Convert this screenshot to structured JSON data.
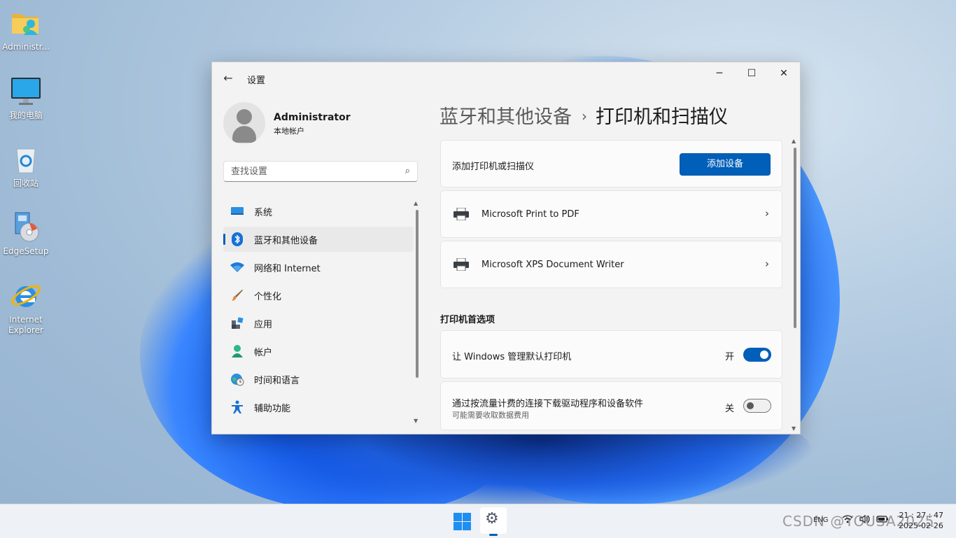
{
  "desktop": {
    "icons": [
      {
        "label": "Administr...",
        "icon": "user-folder-icon"
      },
      {
        "label": "我的电脑",
        "icon": "monitor-icon"
      },
      {
        "label": "回收站",
        "icon": "recycle-bin-icon"
      },
      {
        "label": "EdgeSetup",
        "icon": "installer-disc-icon"
      },
      {
        "label": "Internet\nExplorer",
        "icon": "internet-explorer-icon"
      }
    ]
  },
  "window": {
    "app_title": "设置",
    "back_icon": "back-arrow-icon",
    "controls": {
      "minimize": "─",
      "maximize": "☐",
      "close": "✕"
    }
  },
  "profile": {
    "name": "Administrator",
    "account_type": "本地帐户"
  },
  "search": {
    "placeholder": "查找设置",
    "icon": "search-icon"
  },
  "nav": {
    "items": [
      {
        "label": "系统",
        "icon": "system-icon",
        "active": false
      },
      {
        "label": "蓝牙和其他设备",
        "icon": "bluetooth-icon",
        "active": true
      },
      {
        "label": "网络和 Internet",
        "icon": "wifi-icon",
        "active": false
      },
      {
        "label": "个性化",
        "icon": "brush-icon",
        "active": false
      },
      {
        "label": "应用",
        "icon": "apps-icon",
        "active": false
      },
      {
        "label": "帐户",
        "icon": "account-icon",
        "active": false
      },
      {
        "label": "时间和语言",
        "icon": "globe-clock-icon",
        "active": false
      },
      {
        "label": "辅助功能",
        "icon": "accessibility-icon",
        "active": false
      }
    ]
  },
  "breadcrumb": {
    "parent": "蓝牙和其他设备",
    "separator": "›",
    "current": "打印机和扫描仪"
  },
  "add_device": {
    "label": "添加打印机或扫描仪",
    "button": "添加设备"
  },
  "printers": [
    {
      "name": "Microsoft Print to PDF"
    },
    {
      "name": "Microsoft XPS Document Writer"
    }
  ],
  "preferences": {
    "title": "打印机首选项",
    "settings": [
      {
        "label": "让 Windows 管理默认打印机",
        "state_text": "开",
        "on": true
      },
      {
        "label": "通过按流量计费的连接下载驱动程序和设备软件",
        "description": "可能需要收取数据费用",
        "state_text": "关",
        "on": false
      }
    ]
  },
  "taskbar": {
    "tray": {
      "lang": "ENG",
      "wifi": "wifi-icon",
      "sound": "speaker-icon",
      "battery": "battery-icon"
    },
    "time": "21 : 27 : 47",
    "date": "2025-02-26"
  },
  "watermark": "CSDN @YOUSA2025",
  "colors": {
    "accent": "#005fb8",
    "window_bg": "#f3f3f3",
    "card_bg": "#fbfbfb"
  }
}
